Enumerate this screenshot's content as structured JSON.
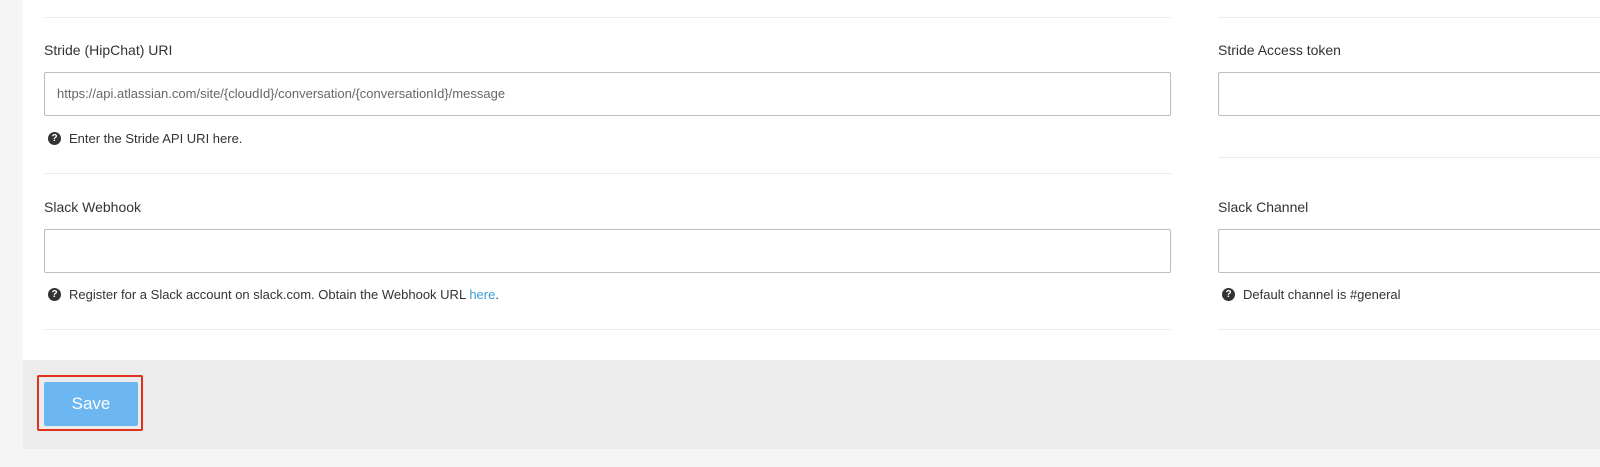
{
  "stride": {
    "uri_label": "Stride (HipChat) URI",
    "uri_value": "https://api.atlassian.com/site/{cloudId}/conversation/{conversationId}/message",
    "uri_help": "Enter the Stride API URI here.",
    "token_label": "Stride Access token",
    "token_value": ""
  },
  "slack": {
    "webhook_label": "Slack Webhook",
    "webhook_value": "",
    "webhook_help_prefix": "Register for a Slack account on slack.com. Obtain the Webhook URL ",
    "webhook_help_link": "here",
    "webhook_help_suffix": ".",
    "channel_label": "Slack Channel",
    "channel_value": "",
    "channel_help": "Default channel is #general"
  },
  "help_icon_glyph": "?",
  "footer": {
    "save_label": "Save"
  },
  "colors": {
    "save_button": "#6cb6f2",
    "highlight_border": "#e0321c",
    "link": "#3d9bd6"
  }
}
